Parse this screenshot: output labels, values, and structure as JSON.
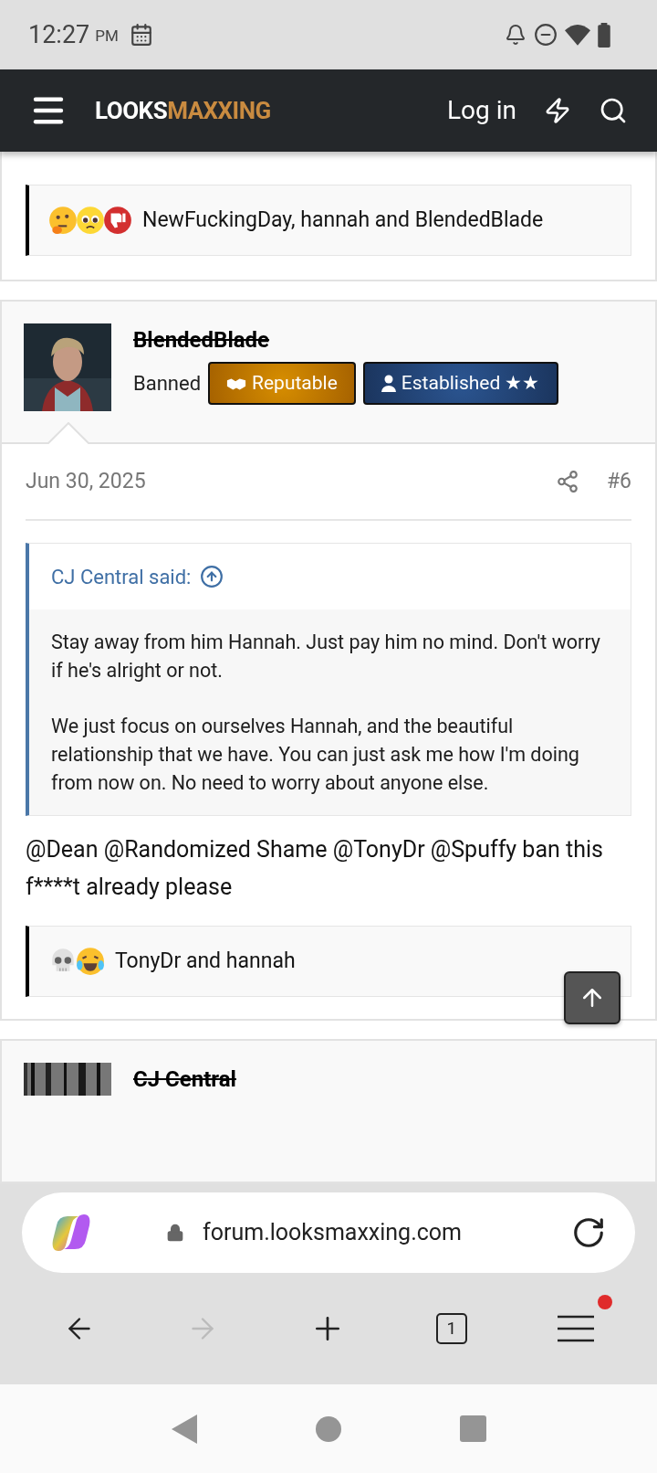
{
  "status_bar": {
    "time": "12:27",
    "period": "PM"
  },
  "header": {
    "logo": [
      {
        "text": "LOOKS",
        "kind": "plain"
      },
      {
        "text": "MAXXING",
        "kind": "accent"
      }
    ],
    "login": "Log in"
  },
  "previous_reactions": {
    "emojis": [
      {
        "kind": "thinking"
      },
      {
        "kind": "pleading"
      },
      {
        "kind": "dislike"
      }
    ],
    "users": "NewFuckingDay, hannah and BlendedBlade"
  },
  "post": {
    "author": "BlendedBlade",
    "banned": true,
    "role": "Banned",
    "badges": [
      {
        "kind": "reputable",
        "label": "Reputable"
      },
      {
        "kind": "established",
        "label": "Established ★★"
      }
    ],
    "date": "Jun 30, 2025",
    "number": "#6",
    "quote": {
      "author": "CJ Central said:",
      "paragraphs": [
        "Stay away from him Hannah. Just pay him no mind. Don't worry if he's alright or not.",
        "We just focus on ourselves Hannah, and the beautiful relationship that we have. You can just ask me how I'm doing from now on. No need to worry about anyone else."
      ]
    },
    "message": "@Dean @Randomized Shame @TonyDr @Spuffy ban this f****t already please",
    "reactions": {
      "emojis": [
        {
          "kind": "skull"
        },
        {
          "kind": "joy"
        }
      ],
      "users": "TonyDr and hannah"
    }
  },
  "next_post": {
    "author": "CJ Central",
    "banned": true
  },
  "browser": {
    "url": "forum.looksmaxxing.com",
    "tab_count": "1",
    "forward_disabled": true,
    "menu_notification": true
  }
}
